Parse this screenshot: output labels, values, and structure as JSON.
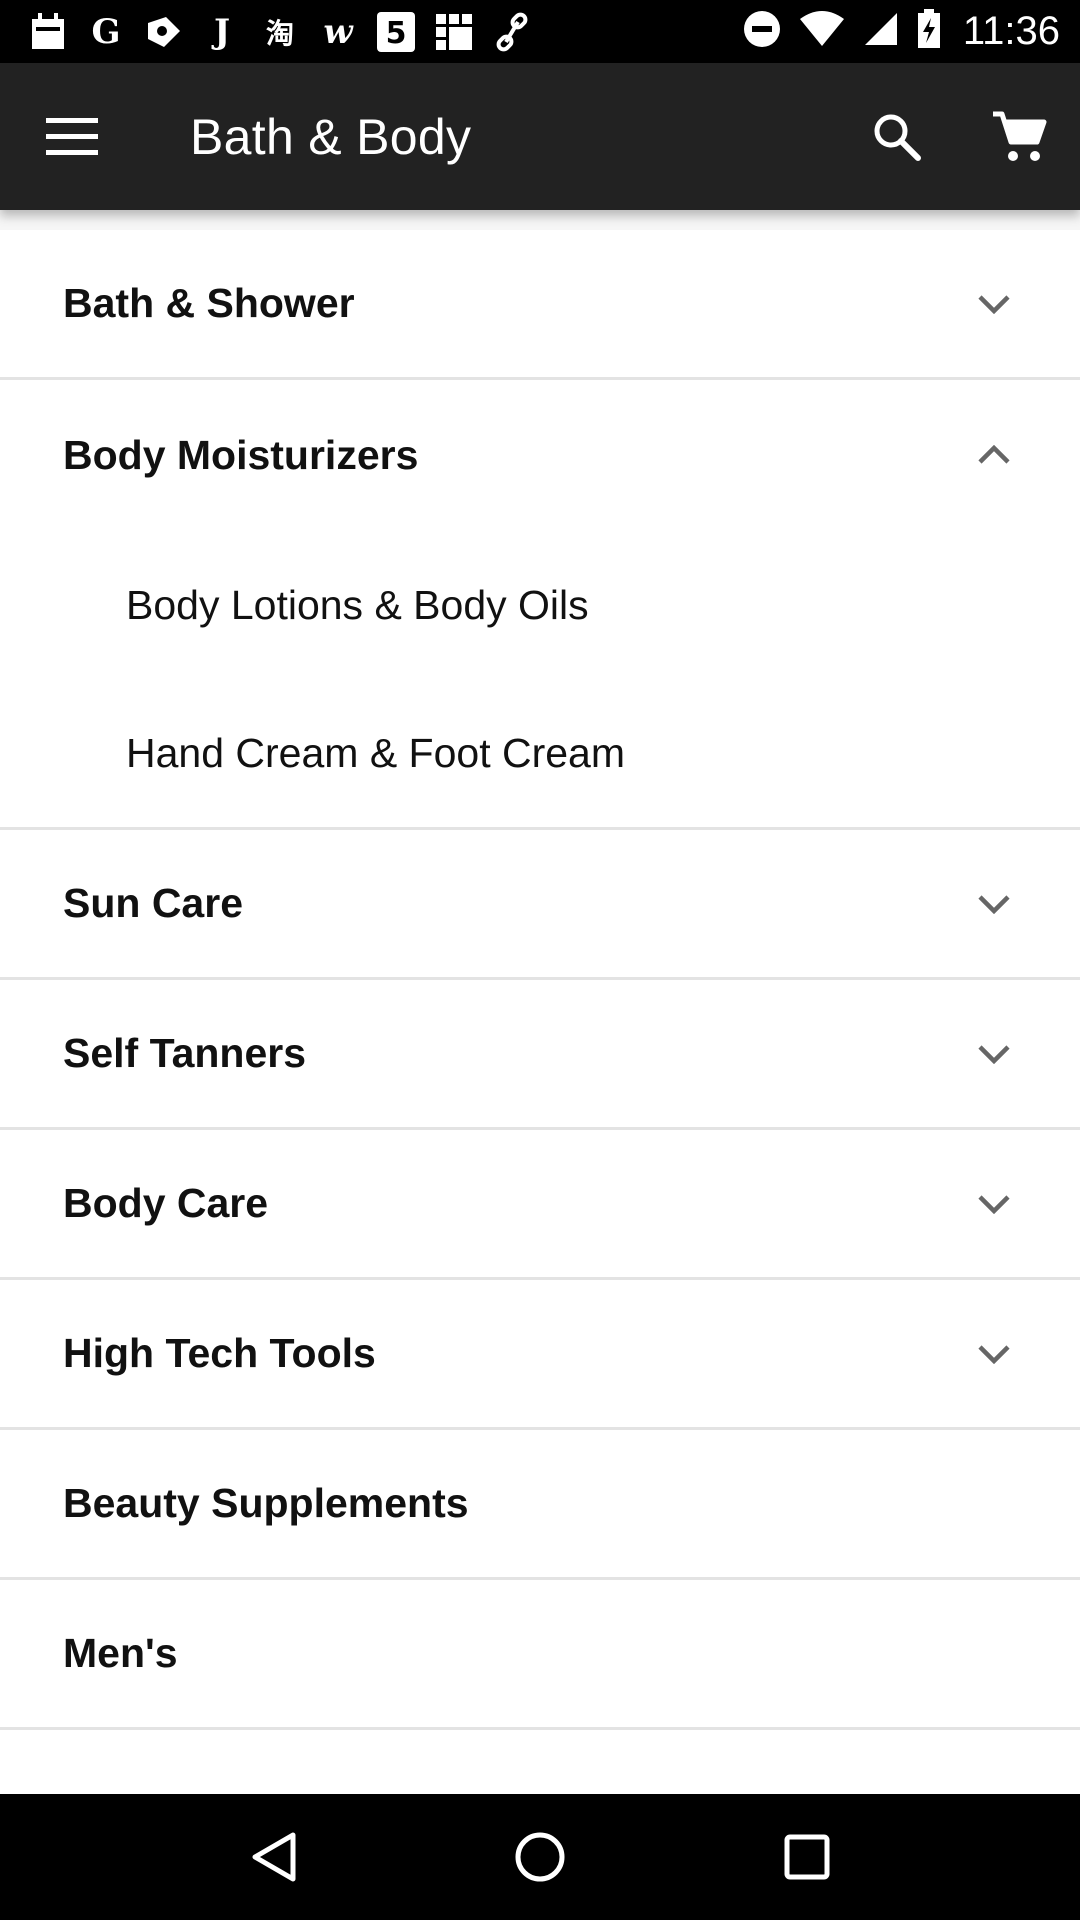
{
  "status_bar": {
    "time": "11:36",
    "notification_icons": [
      "calendar-icon",
      "google-icon",
      "tag-icon",
      "j-icon",
      "taobao-icon",
      "wish-icon",
      "html5-icon",
      "grid-app-icon",
      "link-icon"
    ],
    "notification_glyphs": [
      "",
      "G",
      "",
      "J",
      "淘",
      "w",
      "5",
      "",
      ""
    ]
  },
  "app_bar": {
    "title": "Bath & Body",
    "menu_icon": "hamburger-menu-icon",
    "search_icon": "search-icon",
    "cart_icon": "cart-icon"
  },
  "categories": [
    {
      "label": "Bath & Shower",
      "chevron": "down"
    },
    {
      "label": "Body Moisturizers",
      "chevron": "up",
      "children": [
        {
          "label": "Body Lotions & Body Oils"
        },
        {
          "label": "Hand Cream & Foot Cream"
        }
      ]
    },
    {
      "label": "Sun Care",
      "chevron": "down"
    },
    {
      "label": "Self Tanners",
      "chevron": "down"
    },
    {
      "label": "Body Care",
      "chevron": "down"
    },
    {
      "label": "High Tech Tools",
      "chevron": "down"
    },
    {
      "label": "Beauty Supplements",
      "chevron": "none"
    },
    {
      "label": "Men's",
      "chevron": "none"
    }
  ],
  "nav_bar": {
    "back_icon": "back-triangle-icon",
    "home_icon": "home-circle-icon",
    "recents_icon": "recents-square-icon"
  }
}
